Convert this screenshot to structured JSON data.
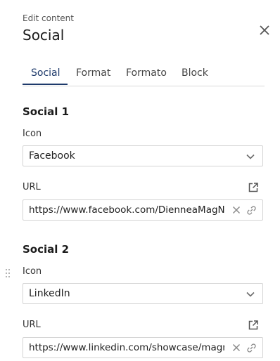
{
  "header": {
    "subtitle": "Edit content",
    "title": "Social"
  },
  "tabs": [
    {
      "label": "Social",
      "active": true
    },
    {
      "label": "Format",
      "active": false
    },
    {
      "label": "Formato",
      "active": false
    },
    {
      "label": "Block",
      "active": false
    }
  ],
  "sections": [
    {
      "title": "Social 1",
      "icon_label": "Icon",
      "icon_value": "Facebook",
      "url_label": "URL",
      "url_value": "https://www.facebook.com/DienneaMagNews"
    },
    {
      "title": "Social 2",
      "icon_label": "Icon",
      "icon_value": "LinkedIn",
      "url_label": "URL",
      "url_value": "https://www.linkedin.com/showcase/magnews"
    }
  ],
  "colors": {
    "accent": "#1e3a6b",
    "border": "#d4d4d4",
    "icon": "#8a8a8a"
  }
}
